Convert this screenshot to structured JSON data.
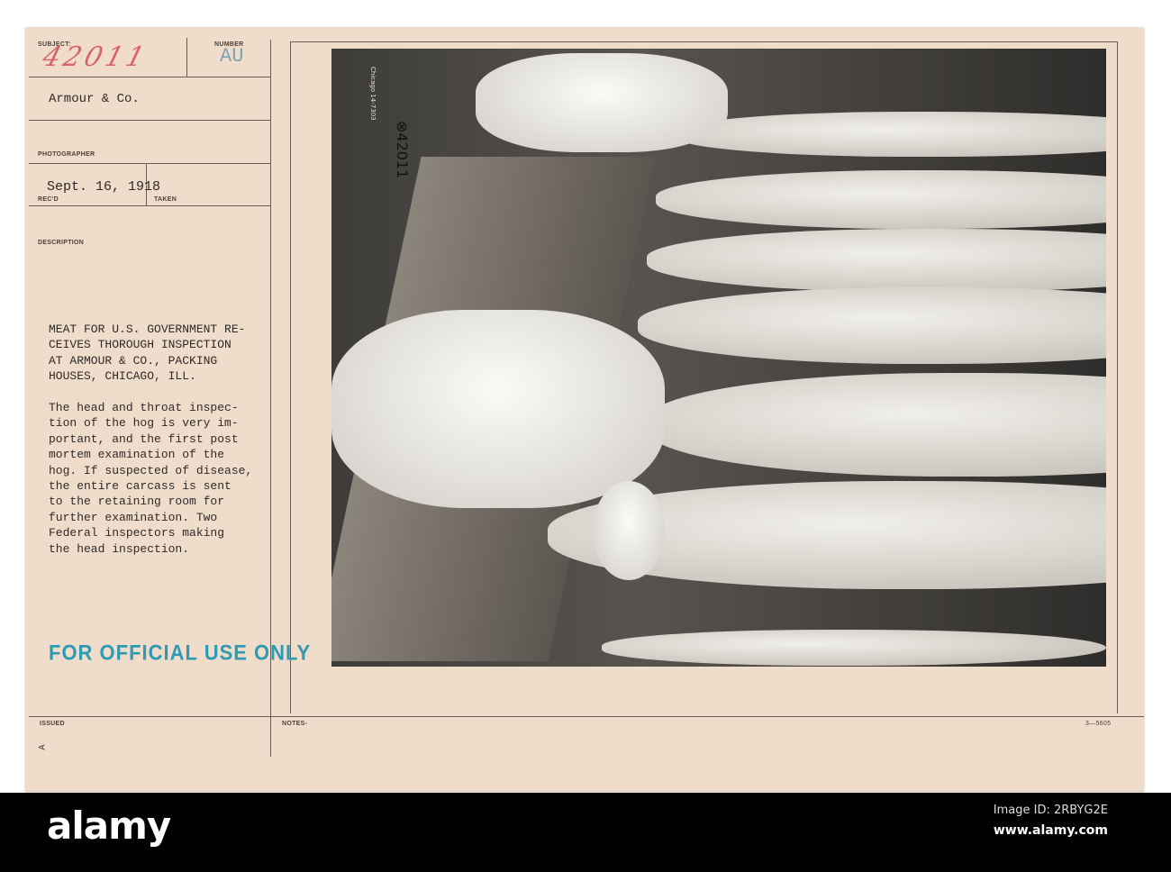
{
  "card": {
    "subject_label": "SUBJECT:",
    "subject_value": "42011",
    "number_label": "NUMBER",
    "number_value": "AU",
    "source": "Armour & Co.",
    "photographer_label": "PHOTOGRAPHER",
    "date": "Sept. 16, 1918",
    "recd_label": "REC'D",
    "taken_label": "TAKEN",
    "description_label": "DESCRIPTION",
    "headline": "MEAT FOR U.S. GOVERNMENT RE-\nCEIVES THOROUGH INSPECTION\nAT ARMOUR & CO., PACKING\nHOUSES, CHICAGO, ILL.",
    "body": "The head and throat inspec-\ntion of the hog is very im-\nportant, and the first post\nmortem examination of the\nhog. If suspected of disease,\nthe entire carcass is sent\nto the retaining room for\nfurther examination. Two\nFederal inspectors making\nthe head inspection.",
    "stamp": "FOR OFFICIAL USE ONLY",
    "issued_label": "ISSUED",
    "issued_mark": "A",
    "notes_label": "NOTES-",
    "form_number": "3—5605"
  },
  "photo": {
    "negative_number": "⊗42011",
    "handwritten": "Chicago 14-7303"
  },
  "footer": {
    "logo": "alamy",
    "image_id": "Image ID: 2RBYG2E",
    "url": "www.alamy.com"
  },
  "colors": {
    "card": "#efdccb",
    "stamp": "#2f9bb3",
    "subject_ink": "#d9636b",
    "number_ink": "#7fa3b5"
  }
}
